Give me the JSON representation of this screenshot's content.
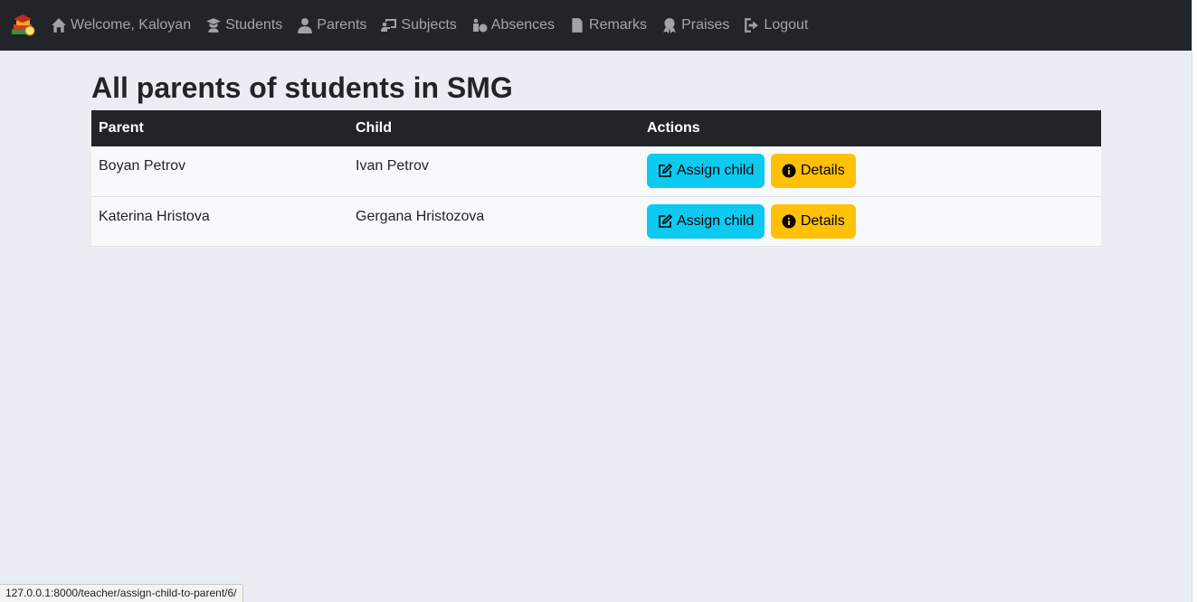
{
  "nav": {
    "items": [
      {
        "label": "Welcome, Kaloyan",
        "icon": "home-icon"
      },
      {
        "label": "Students",
        "icon": "graduate-icon"
      },
      {
        "label": "Parents",
        "icon": "user-icon"
      },
      {
        "label": "Subjects",
        "icon": "chalkboard-teacher-icon"
      },
      {
        "label": "Absences",
        "icon": "absence-icon"
      },
      {
        "label": "Remarks",
        "icon": "file-icon"
      },
      {
        "label": "Praises",
        "icon": "award-icon"
      },
      {
        "label": "Logout",
        "icon": "logout-icon"
      }
    ]
  },
  "page": {
    "title": "All parents of students in SMG"
  },
  "table": {
    "headers": {
      "parent": "Parent",
      "child": "Child",
      "actions": "Actions"
    },
    "rows": [
      {
        "parent": "Boyan Petrov",
        "child": "Ivan Petrov",
        "assign_label": "Assign child",
        "details_label": "Details"
      },
      {
        "parent": "Katerina Hristova",
        "child": "Gergana Hristozova",
        "assign_label": "Assign child",
        "details_label": "Details"
      }
    ]
  },
  "status_bar": {
    "url": "127.0.0.1:8000/teacher/assign-child-to-parent/6/"
  },
  "colors": {
    "navbar": "#212529",
    "info_button": "#0dcaf0",
    "warning_button": "#ffc107",
    "background": "#eaedf4"
  }
}
